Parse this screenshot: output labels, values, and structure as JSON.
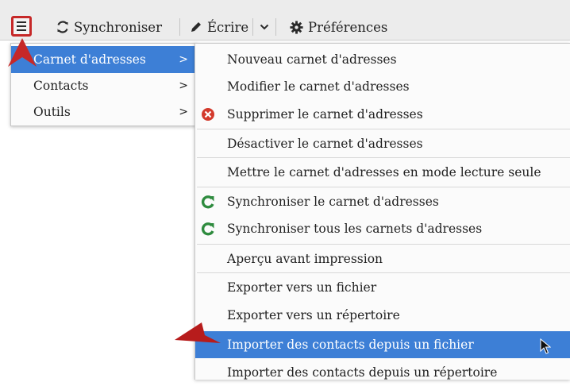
{
  "toolbar": {
    "sync_label": "Synchroniser",
    "write_label": "Écrire",
    "prefs_label": "Préférences"
  },
  "main_menu": {
    "items": [
      {
        "label": "Carnet d'adresses",
        "arrow": ">"
      },
      {
        "label": "Contacts",
        "arrow": ">"
      },
      {
        "label": "Outils",
        "arrow": ">"
      }
    ]
  },
  "submenu": {
    "items": [
      {
        "label": "Nouveau carnet d'adresses"
      },
      {
        "label": "Modifier le carnet d'adresses"
      },
      {
        "label": "Supprimer le carnet d'adresses",
        "icon": "delete-icon"
      },
      {
        "label": "Désactiver le carnet d'adresses"
      },
      {
        "label": "Mettre le carnet d'adresses en mode lecture seule"
      },
      {
        "label": "Synchroniser le carnet d'adresses",
        "icon": "sync-icon"
      },
      {
        "label": "Synchroniser tous les carnets d'adresses",
        "icon": "sync-icon"
      },
      {
        "label": "Aperçu avant impression"
      },
      {
        "label": "Exporter vers un fichier"
      },
      {
        "label": "Exporter vers un répertoire"
      },
      {
        "label": "Importer des contacts depuis un fichier"
      },
      {
        "label": "Importer des contacts depuis un répertoire"
      }
    ]
  },
  "colors": {
    "highlight": "#3d7fd6",
    "annotation_red": "#c62828",
    "sync_green": "#2e8b3e",
    "delete_red": "#d33a2c"
  }
}
